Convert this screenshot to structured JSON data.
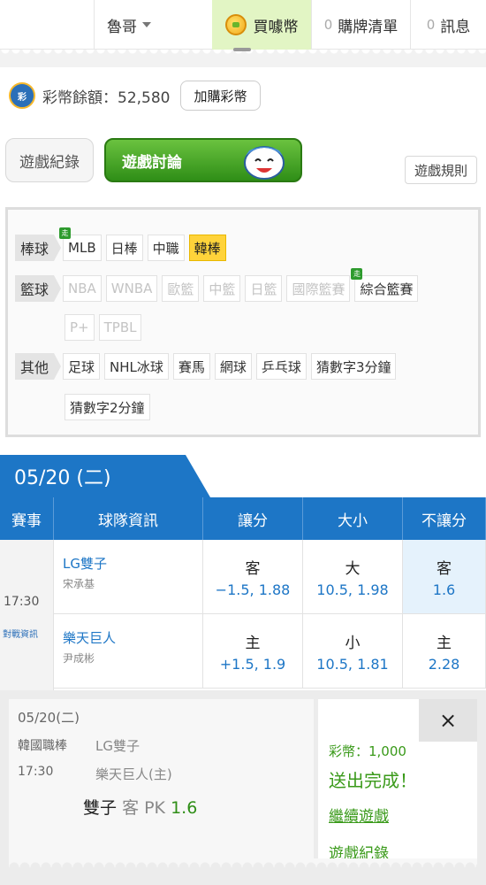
{
  "topbar": {
    "user": "魯哥",
    "buy_label": "買噱幣",
    "cart_count": "0",
    "cart_label": "購牌清單",
    "msg_count": "0",
    "msg_label": "訊息"
  },
  "balance": {
    "label": "彩幣餘額：52,580",
    "add_button": "加購彩幣"
  },
  "tabs": {
    "record": "遊戲紀錄",
    "discuss": "遊戲討論",
    "rules": "遊戲規則"
  },
  "categories": {
    "baseball": {
      "label": "棒球",
      "items": [
        "MLB",
        "日棒",
        "中職",
        "韓棒"
      ]
    },
    "basketball": {
      "label": "籃球",
      "items": [
        "NBA",
        "WNBA",
        "歐籃",
        "中籃",
        "日籃",
        "國際籃賽",
        "綜合籃賽",
        "P+",
        "TPBL"
      ]
    },
    "others": {
      "label": "其他",
      "items": [
        "足球",
        "NHL冰球",
        "賽馬",
        "網球",
        "乒乓球",
        "猜數字3分鐘",
        "猜數字2分鐘"
      ]
    },
    "badge_text": "走"
  },
  "date_tab": "05/20 (二)",
  "table": {
    "headers": [
      "賽事",
      "球隊資訊",
      "讓分",
      "大小",
      "不讓分"
    ],
    "time": "17:30",
    "matchup_info": "對戰資訊",
    "rows": [
      {
        "team": "LG雙子",
        "pitcher": "宋承基",
        "spread_side": "客",
        "spread_val": "−1.5, 1.88",
        "ou_side": "大",
        "ou_val": "10.5, 1.98",
        "ml_side": "客",
        "ml_val": "1.6"
      },
      {
        "team": "樂天巨人",
        "pitcher": "尹成彬",
        "spread_side": "主",
        "spread_val": "+1.5, 1.9",
        "ou_side": "小",
        "ou_val": "10.5, 1.81",
        "ml_side": "主",
        "ml_val": "2.28"
      }
    ]
  },
  "ticket": {
    "date": "05/20(二)",
    "league": "韓國職棒",
    "time": "17:30",
    "away": "LG雙子",
    "home": "樂天巨人(主)",
    "pick_team": "雙子",
    "pick_side": "客 PK",
    "pick_odds": "1.6"
  },
  "result": {
    "close": "×",
    "amount": "彩幣：1,000",
    "done": "送出完成！",
    "continue": "繼續遊戲",
    "record": "遊戲紀錄"
  },
  "colors": {
    "primary_blue": "#1d76c6",
    "green": "#3a9a1a",
    "active_chip": "#ffd33a"
  }
}
